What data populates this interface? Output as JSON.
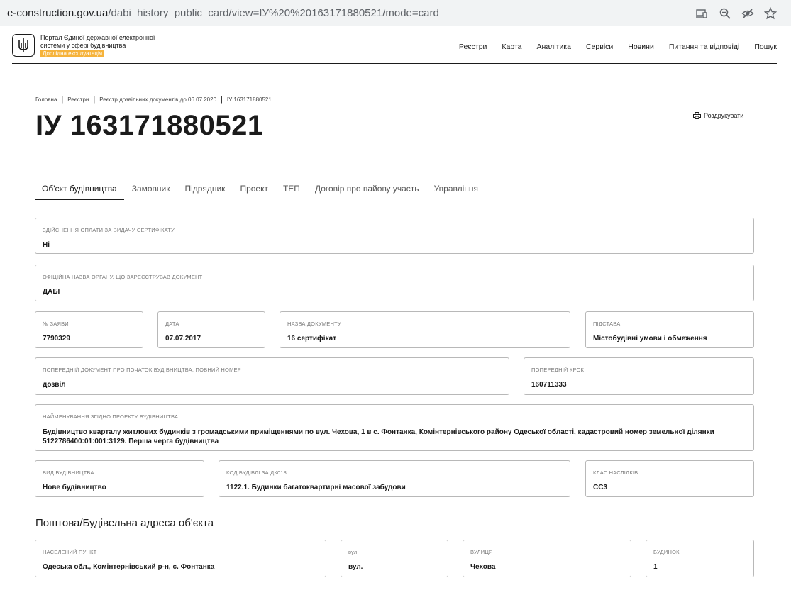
{
  "browser": {
    "url_domain": "e-construction.gov.ua",
    "url_path": "/dabi_history_public_card/view=IУ%20%20163171880521/mode=card"
  },
  "header": {
    "portal_title": "Портал Єдиної державної електронної системи у сфері будівництва",
    "badge": "Дослідна експлуатація",
    "nav": [
      "Реєстри",
      "Карта",
      "Аналітика",
      "Сервіси",
      "Новини",
      "Питання та відповіді",
      "Пошук"
    ]
  },
  "breadcrumb": [
    "Головна",
    "Реєстри",
    "Реєстр дозвільних документів до 06.07.2020",
    "ІУ 163171880521"
  ],
  "page": {
    "title": "ІУ 163171880521",
    "print_label": "Роздрукувати"
  },
  "tabs": [
    "Об'єкт будівництва",
    "Замовник",
    "Підрядник",
    "Проект",
    "ТЕП",
    "Договір про пайову участь",
    "Управління"
  ],
  "fields": {
    "payment": {
      "label": "Здійснення оплати за видачу сертифікату",
      "value": "Ні"
    },
    "authority": {
      "label": "Офіційна назва органу, що зареєстрував документ",
      "value": "ДАБІ"
    },
    "app_no": {
      "label": "№ заяви",
      "value": "7790329"
    },
    "date": {
      "label": "Дата",
      "value": "07.07.2017"
    },
    "doc_name": {
      "label": "Назва документу",
      "value": "16 сертифікат"
    },
    "basis": {
      "label": "Підстава",
      "value": "Містобудівні умови і обмеження"
    },
    "prev_doc": {
      "label": "Попередній документ про початок будівництва, повний номер",
      "value": "дозвіл"
    },
    "prev_step": {
      "label": "Попередній крок",
      "value": "160711333"
    },
    "project_name": {
      "label": "Найменування згідно проекту будівництва",
      "value": "Будівництво кварталу житлових будинків з громадськими приміщеннями по вул. Чехова, 1 в с. Фонтанка, Комінтернівського району Одеської області, кадастровий номер земельної ділянки 5122786400:01:001:3129. Перша черга будівництва"
    },
    "build_type": {
      "label": "Вид будівництва",
      "value": "Нове будівництво"
    },
    "dk018": {
      "label": "Код будівлі за ДК018",
      "value": "1122.1. Будинки багатоквартирні масової забудови"
    },
    "consequence": {
      "label": "Клас наслідків",
      "value": "СС3"
    }
  },
  "address": {
    "title": "Поштова/Будівельна адреса об'єкта",
    "settlement": {
      "label": "Населений пункт",
      "value": "Одеська обл., Комінтернівський р-н, с. Фонтанка"
    },
    "street_type": {
      "label": "вул.",
      "value": "вул."
    },
    "street": {
      "label": "Вулиця",
      "value": "Чехова"
    },
    "building": {
      "label": "Будинок",
      "value": "1"
    }
  }
}
